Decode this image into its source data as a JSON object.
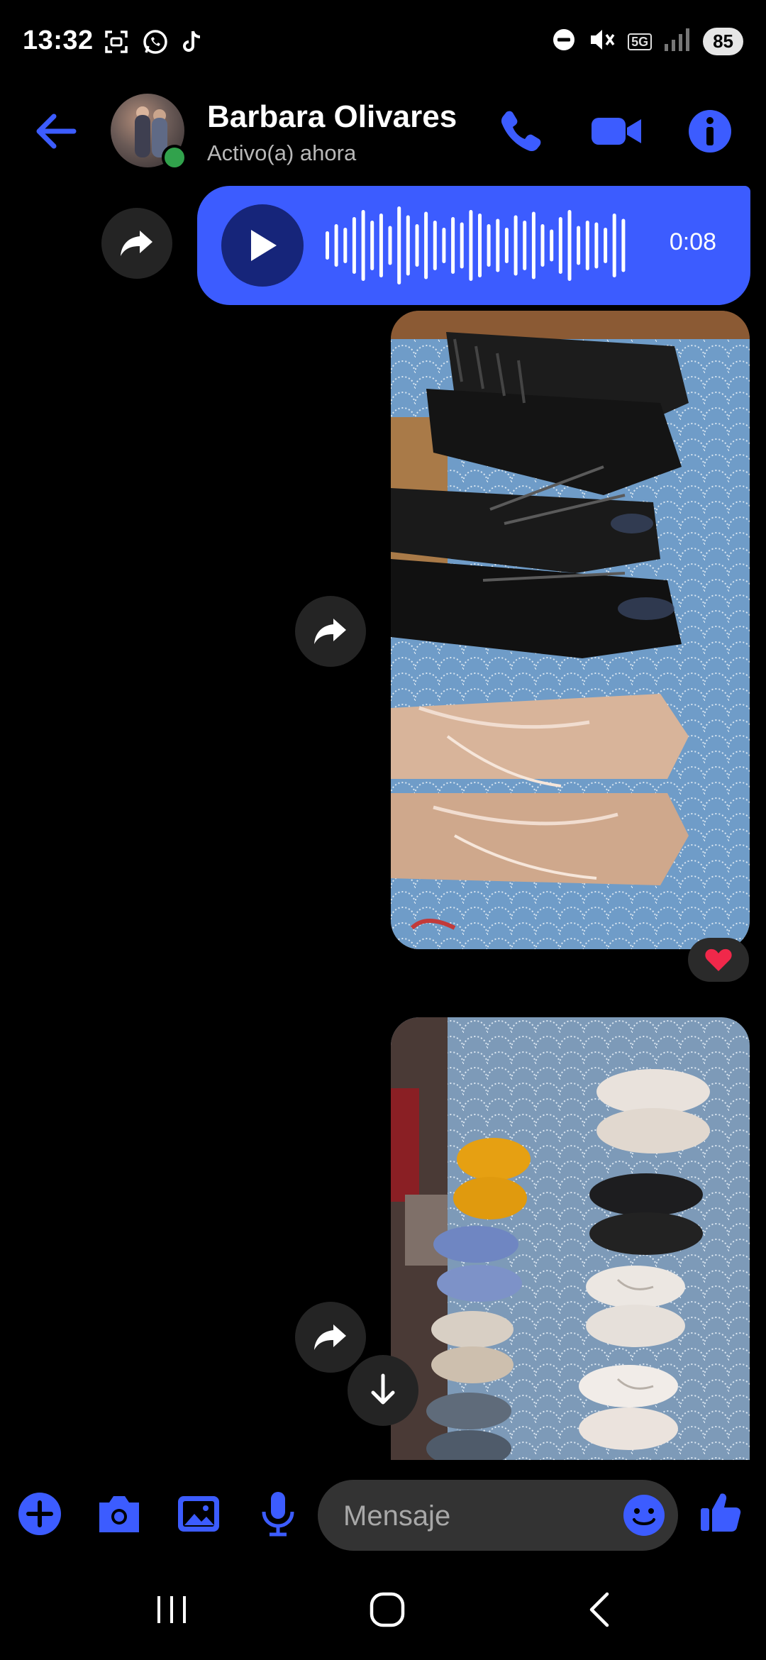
{
  "status_bar": {
    "time": "13:32",
    "network": "5G",
    "battery": "85",
    "left_icons": [
      "screenshot-icon",
      "whatsapp-icon",
      "tiktok-icon"
    ],
    "right_icons": [
      "dnd-icon",
      "mute-icon",
      "network-5g-icon",
      "signal-icon",
      "battery-icon"
    ]
  },
  "header": {
    "contact_name": "Barbara Olivares",
    "status": "Activo(a) ahora",
    "online": true,
    "accent_color": "#3c5cff"
  },
  "messages": [
    {
      "type": "voice",
      "duration": "0:08",
      "bubble_color": "#3c5cff"
    },
    {
      "type": "image",
      "description_icon": "photo",
      "reaction": "❤️"
    },
    {
      "type": "image",
      "description_icon": "photo"
    }
  ],
  "composer": {
    "placeholder": "Mensaje",
    "icons": [
      "add-icon",
      "camera-icon",
      "gallery-icon",
      "microphone-icon",
      "emoji-icon",
      "thumbs-up-icon"
    ]
  },
  "nav_bar": {
    "buttons": [
      "recent-apps",
      "home",
      "back"
    ]
  }
}
